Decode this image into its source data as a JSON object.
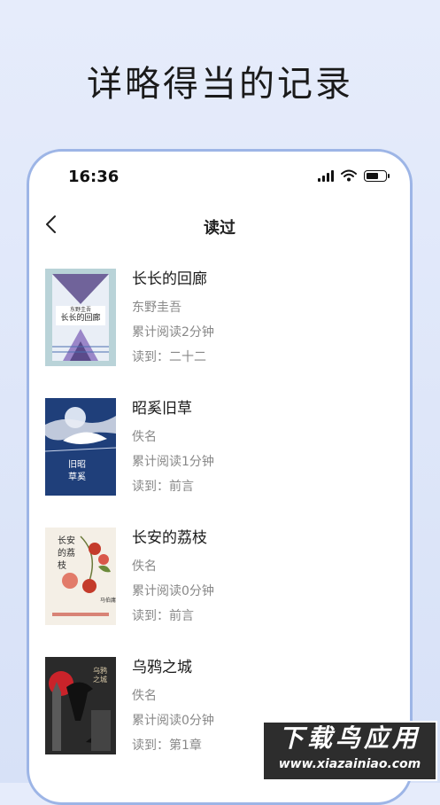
{
  "headline": "详略得当的记录",
  "status": {
    "time": "16:36"
  },
  "nav": {
    "title": "读过"
  },
  "books": [
    {
      "title": "长长的回廊",
      "author": "东野圭吾",
      "read_time": "累计阅读2分钟",
      "progress": "读到：二十二",
      "cover": {
        "top_text": "东野圭吾",
        "main_text": "长长的回廊",
        "bg": "#b9d3d8",
        "accent": "#5b4a8a"
      }
    },
    {
      "title": "昭奚旧草",
      "author": "佚名",
      "read_time": "累计阅读1分钟",
      "progress": "读到：前言",
      "cover": {
        "main_text": "旧昭\n草奚",
        "bg": "#1f3f7a",
        "accent": "#ffffff"
      }
    },
    {
      "title": "长安的荔枝",
      "author": "佚名",
      "read_time": "累计阅读0分钟",
      "progress": "读到：前言",
      "cover": {
        "main_text": "长安的荔枝",
        "sub_text": "马伯庸",
        "bg": "#f4efe6",
        "accent": "#c43b2b"
      }
    },
    {
      "title": "乌鸦之城",
      "author": "佚名",
      "read_time": "累计阅读0分钟",
      "progress": "读到：第1章",
      "cover": {
        "main_text": "乌鸦之城",
        "bg": "#2a2a2a",
        "accent": "#c9232a"
      }
    }
  ],
  "watermark": {
    "line1": "下载鸟应用",
    "line2": "www.xiazainiao.com"
  }
}
